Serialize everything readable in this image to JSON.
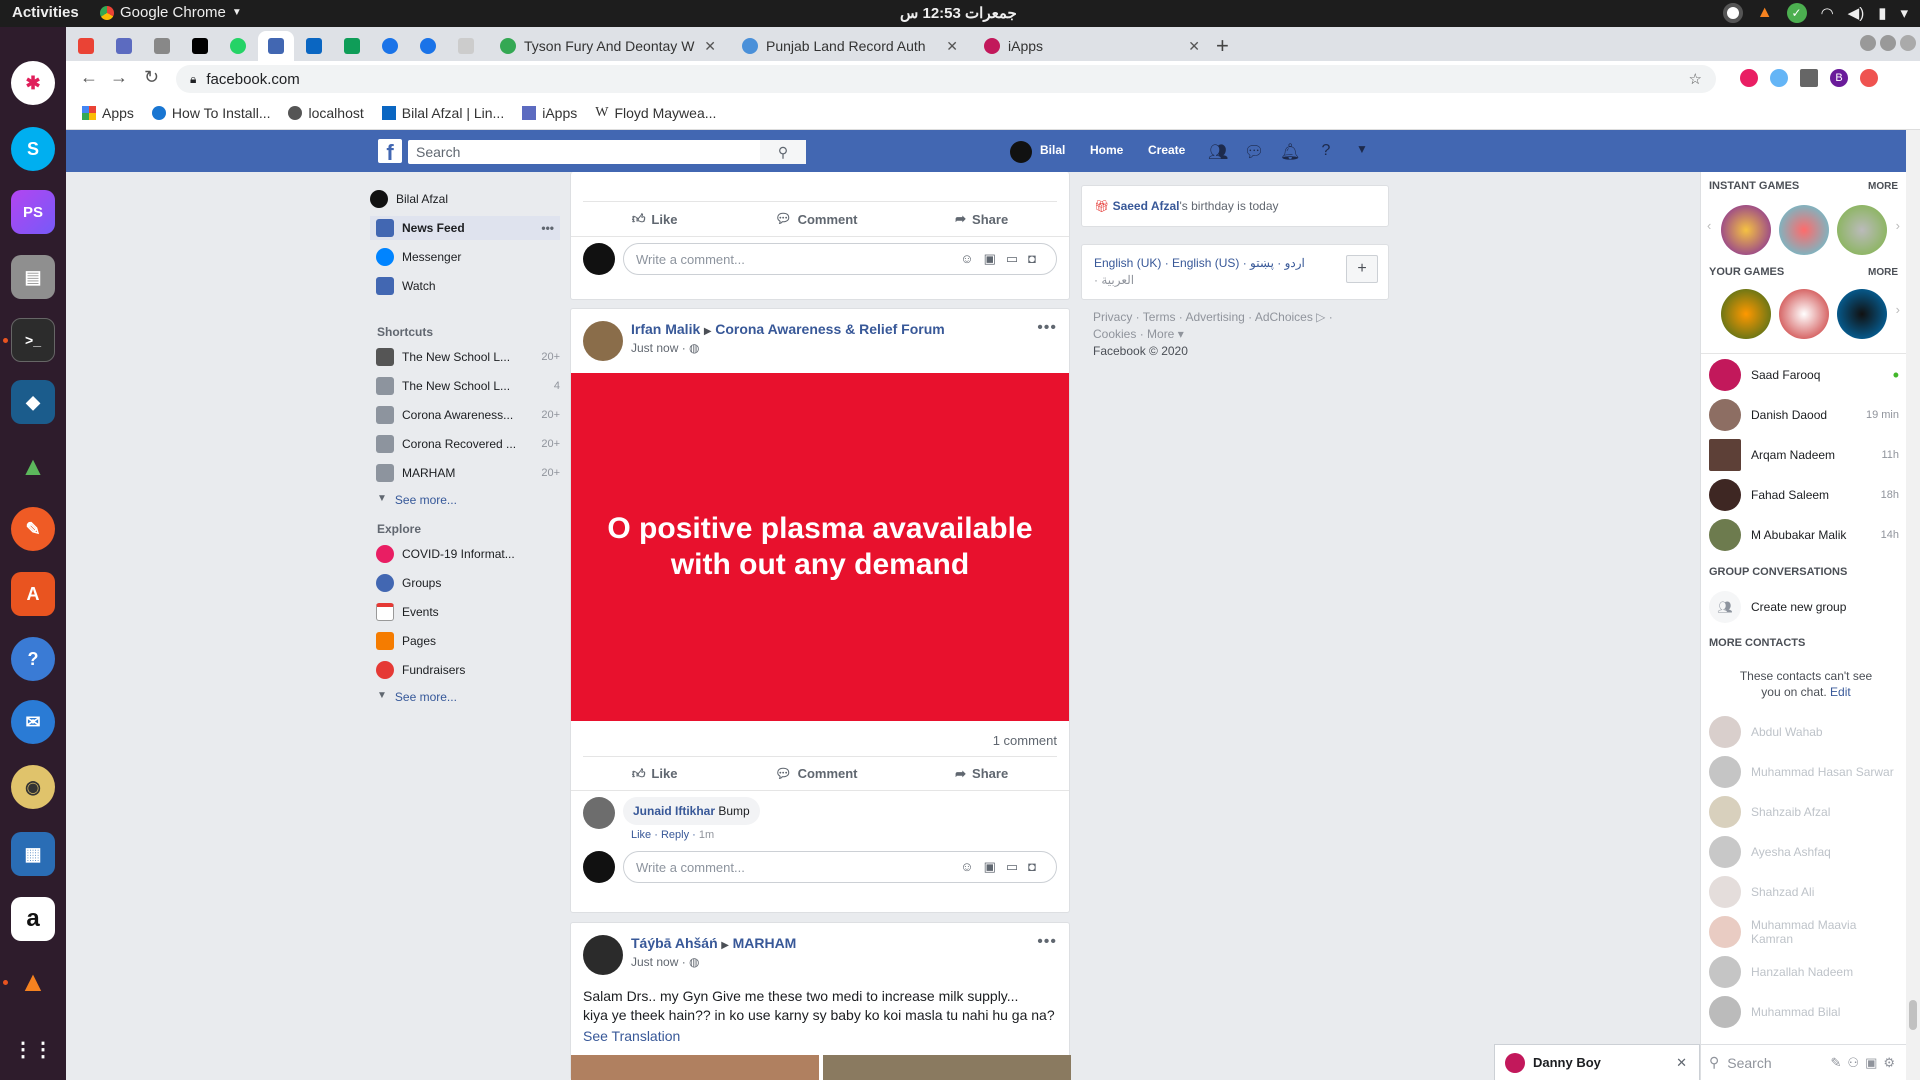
{
  "os": {
    "activities": "Activities",
    "app_name": "Google Chrome",
    "clock": "جمعرات 12:53 س"
  },
  "dock": {
    "items": [
      "Slack",
      "Skype",
      "PhpStorm",
      "Files",
      "Terminal",
      "MySQL Workbench",
      "Robo",
      "Postman",
      "Software",
      "Help",
      "Thunderbird",
      "Rhythmbox",
      "LibreOffice Writer",
      "Amazon",
      "VLC",
      "Show Applications"
    ]
  },
  "browser": {
    "tabs": [
      {
        "label": "Tyson Fury And Deontay W",
        "favicon_color": "#34a853"
      },
      {
        "label": "Punjab Land Record Auth",
        "favicon_color": "#4a90d9"
      },
      {
        "label": "iApps",
        "favicon_color": "#c2185b"
      }
    ],
    "url": "facebook.com",
    "bookmarks": [
      {
        "label": "Apps"
      },
      {
        "label": "How To Install..."
      },
      {
        "label": "localhost"
      },
      {
        "label": "Bilal Afzal | Lin..."
      },
      {
        "label": "iApps"
      },
      {
        "label": "Floyd Maywea..."
      }
    ],
    "profile_initial": "B"
  },
  "fb_header": {
    "search_placeholder": "Search",
    "user_name": "Bilal",
    "home": "Home",
    "create": "Create"
  },
  "left_nav": {
    "profile": "Bilal Afzal",
    "main": [
      {
        "label": "News Feed"
      },
      {
        "label": "Messenger"
      },
      {
        "label": "Watch"
      }
    ],
    "shortcuts_title": "Shortcuts",
    "shortcuts": [
      {
        "label": "The New School L...",
        "count": "20+"
      },
      {
        "label": "The New School L...",
        "count": "4"
      },
      {
        "label": "Corona Awareness...",
        "count": "20+"
      },
      {
        "label": "Corona Recovered ...",
        "count": "20+"
      },
      {
        "label": "MARHAM",
        "count": "20+"
      }
    ],
    "see_more": "See more...",
    "explore_title": "Explore",
    "explore": [
      {
        "label": "COVID-19 Informat..."
      },
      {
        "label": "Groups"
      },
      {
        "label": "Events"
      },
      {
        "label": "Pages"
      },
      {
        "label": "Fundraisers"
      }
    ]
  },
  "feed": {
    "actions": {
      "like": "Like",
      "comment": "Comment",
      "share": "Share"
    },
    "comment_placeholder": "Write a comment...",
    "post1": {
      "author": "Irfan Malik",
      "group": "Corona Awareness & Relief Forum",
      "time": "Just now",
      "image_text": "O positive plasma avavailable with out any demand",
      "image_color": "#e8112d",
      "comment_count": "1 comment",
      "comment": {
        "author": "Junaid Iftikhar",
        "text": "Bump",
        "like": "Like",
        "reply": "Reply",
        "time": "1m"
      }
    },
    "post2": {
      "author": "Táýbā Ahšáń",
      "group": "MARHAM",
      "time": "Just now",
      "text_line1": "Salam Drs.. my Gyn Give me these two medi to increase milk supply...",
      "text_line2": "kiya ye theek hain?? in ko use karny sy baby ko koi masla tu nahi hu ga na?",
      "see_translation": "See Translation"
    }
  },
  "right_mid": {
    "birthday_name": "Saeed Afzal",
    "birthday_suffix": "'s birthday is today",
    "languages_line1": "English (UK) · English (US) · اردو · پښتو",
    "languages_line2": "· العربية",
    "footer_line1": "Privacy · Terms · Advertising · AdChoices ▷ ·",
    "footer_line2": "Cookies · More ▾",
    "copyright": "Facebook © 2020"
  },
  "chat": {
    "instant_games": "INSTANT GAMES",
    "your_games": "YOUR GAMES",
    "more": "MORE",
    "online": [
      {
        "name": "Saad Farooq",
        "status": "•"
      },
      {
        "name": "Danish Daood",
        "status": "19 min"
      },
      {
        "name": "Arqam Nadeem",
        "status": "11h"
      },
      {
        "name": "Fahad Saleem",
        "status": "18h"
      },
      {
        "name": "M Abubakar Malik",
        "status": "14h"
      }
    ],
    "group_conversations": "GROUP CONVERSATIONS",
    "create_group": "Create new group",
    "more_contacts": "MORE CONTACTS",
    "hidden_note": "These contacts can't see you on chat.",
    "edit": "Edit",
    "offline": [
      "Abdul Wahab",
      "Muhammad Hasan Sarwar",
      "Shahzaib Afzal",
      "Ayesha Ashfaq",
      "Shahzad Ali",
      "Muhammad Maavia Kamran",
      "Hanzallah Nadeem",
      "Muhammad Bilal"
    ],
    "search_placeholder": "Search",
    "open_chat": "Danny Boy"
  },
  "colors": {
    "fb_blue": "#4267b2",
    "link": "#385898",
    "dock_bg": "#2e1c2c",
    "online_dot": "#42b72a"
  }
}
